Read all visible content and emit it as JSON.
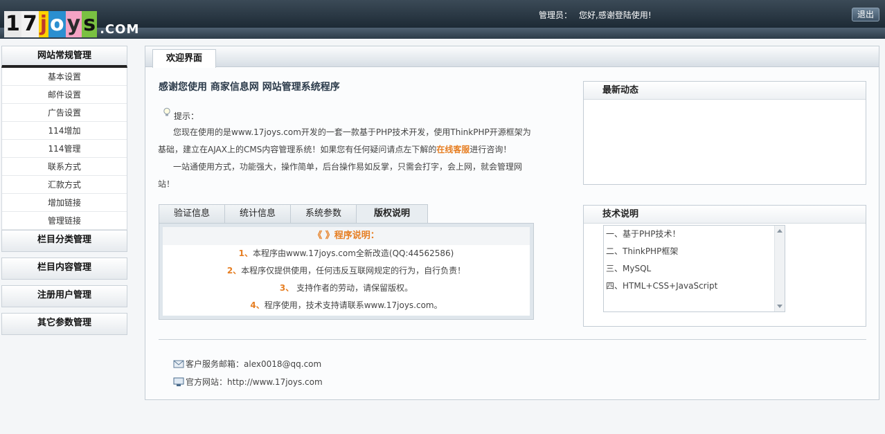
{
  "logo": {
    "chars": [
      "1",
      "7",
      "j",
      "o",
      "y",
      "s"
    ],
    "suffix": ".COM"
  },
  "header": {
    "admin_label": "管理员：",
    "greeting": "您好,感谢登陆使用!",
    "logout_label": "退出"
  },
  "sidebar": {
    "groups": [
      {
        "title": "网站常规管理",
        "items": [
          "基本设置",
          "邮件设置",
          "广告设置",
          "114增加",
          "114管理",
          "联系方式",
          "汇款方式",
          "增加链接",
          "管理链接"
        ]
      },
      {
        "title": "栏目分类管理"
      },
      {
        "title": "栏目内容管理"
      },
      {
        "title": "注册用户管理"
      },
      {
        "title": "其它参数管理"
      }
    ]
  },
  "main": {
    "tab_label": "欢迎界面",
    "title": "感谢您使用 商家信息网 网站管理系统程序",
    "tip_label": "提示：",
    "tip_p1_a": "您现在使用的是www.17joys.com开发的一套一款基于PHP技术开发，使用ThinkPHP开源框架为基础，建立在AJAX上的CMS内容管理系统！如果您有任何疑问请点左下解的",
    "tip_p1_link": "在线客服",
    "tip_p1_b": "进行咨询！",
    "tip_p2": "一站通使用方式，功能强大，操作简单，后台操作易如反掌，只需会打字，会上网，就会管理网站！",
    "inner_tabs": [
      "验证信息",
      "统计信息",
      "系统参数",
      "版权说明"
    ],
    "copyright": {
      "title": "《 》程序说明：",
      "lines": [
        {
          "num": "1、",
          "text": "本程序由www.17joys.com全新改造(QQ:44562586)"
        },
        {
          "num": "2、",
          "text": "本程序仅提供使用，任何违反互联网规定的行为，自行负责！"
        },
        {
          "num": "3、",
          "text": " 支持作者的劳动，请保留版权。"
        },
        {
          "num": "4、",
          "text": "程序使用，技术支持请联系www.17joys.com。"
        }
      ]
    },
    "news": {
      "title": "最新动态"
    },
    "tech": {
      "title": "技术说明",
      "items": [
        "一、基于PHP技术！",
        "二、ThinkPHP框架",
        "三、MySQL",
        "四、HTML+CSS+JavaScript"
      ]
    },
    "contact": {
      "email_label": "客户服务邮箱：",
      "email": "alex0018@qq.com",
      "site_label": "官方网站：",
      "site": "http://www.17joys.com"
    }
  },
  "colors": {
    "accent_orange": "#e67e22",
    "topbar": "#1d2a35"
  }
}
